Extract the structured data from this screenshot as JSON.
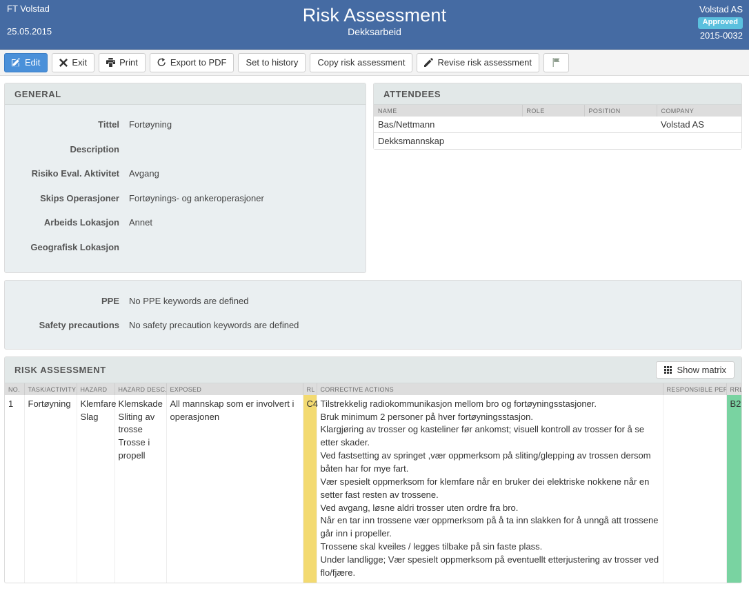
{
  "header": {
    "vessel": "FT Volstad",
    "date": "25.05.2015",
    "title": "Risk Assessment",
    "subtitle": "Dekksarbeid",
    "company": "Volstad AS",
    "status_badge": "Approved",
    "doc_number": "2015-0032",
    "bg_color": "#456ba3",
    "badge_color": "#5bc0de"
  },
  "toolbar": {
    "buttons": [
      {
        "label": "Edit",
        "icon": "pencil-square-icon",
        "primary": true
      },
      {
        "label": "Exit",
        "icon": "close-x-icon",
        "primary": false
      },
      {
        "label": "Print",
        "icon": "printer-icon",
        "primary": false
      },
      {
        "label": "Export to PDF",
        "icon": "external-share-icon",
        "primary": false
      },
      {
        "label": "Set to history",
        "icon": "",
        "primary": false
      },
      {
        "label": "Copy risk assessment",
        "icon": "",
        "primary": false
      },
      {
        "label": "Revise risk assessment",
        "icon": "pencil-icon",
        "primary": false
      },
      {
        "label": "",
        "icon": "flag-icon",
        "primary": false
      }
    ]
  },
  "general": {
    "title": "GENERAL",
    "fields": [
      {
        "label": "Tittel",
        "value": "Fortøyning"
      },
      {
        "label": "Description",
        "value": ""
      },
      {
        "label": "Risiko Eval. Aktivitet",
        "value": "Avgang"
      },
      {
        "label": "Skips Operasjoner",
        "value": "Fortøynings- og ankeroperasjoner"
      },
      {
        "label": "Arbeids Lokasjon",
        "value": "Annet"
      },
      {
        "label": "Geografisk Lokasjon",
        "value": ""
      }
    ]
  },
  "attendees": {
    "title": "ATTENDEES",
    "columns": [
      "NAME",
      "ROLE",
      "POSITION",
      "COMPANY"
    ],
    "rows": [
      {
        "name": "Bas/Nettmann",
        "role": "",
        "position": "",
        "company": "Volstad AS"
      },
      {
        "name": "Dekksmannskap",
        "role": "",
        "position": "",
        "company": ""
      }
    ]
  },
  "ppe": {
    "fields": [
      {
        "label": "PPE",
        "value": "No PPE keywords are defined"
      },
      {
        "label": "Safety precautions",
        "value": "No safety precaution keywords are defined"
      }
    ]
  },
  "risk": {
    "title": "RISK ASSESSMENT",
    "show_matrix_label": "Show matrix",
    "columns": [
      "NO.",
      "TASK/ACTIVITY",
      "HAZARD",
      "HAZARD DESC.",
      "EXPOSED",
      "RL",
      "CORRECTIVE ACTIONS",
      "RESPONSIBLE PERSON",
      "RRL"
    ],
    "rows": [
      {
        "no": "1",
        "task": "Fortøyning",
        "hazard": [
          "Klemfare",
          "Slag"
        ],
        "hazard_desc": [
          "Klemskade",
          "Sliting av trosse",
          "Trosse i propell"
        ],
        "exposed": "All mannskap som er involvert i operasjonen",
        "rl": "C4",
        "rl_color": "#f3da71",
        "corrective_actions": [
          "Tilstrekkelig radiokommunikasjon mellom bro og fortøyningsstasjoner.",
          "Bruk minimum 2 personer på hver fortøyningsstasjon.",
          "Klargjøring av trosser og kasteliner før ankomst; visuell kontroll av trosser for å se etter skader.",
          "Ved fastsetting av springet ,vær oppmerksom på sliting/glepping av trossen dersom båten har for mye fart.",
          "Vær spesielt oppmerksom for klemfare når en bruker dei elektriske nokkene når en setter fast resten av trossene.",
          "Ved avgang, løsne aldri trosser uten ordre fra bro.",
          "Når en tar inn trossene vær oppmerksom på å ta inn slakken for å unngå att trossene går inn i propeller.",
          "Trossene skal kveiles / legges tilbake på sin faste plass.",
          "Under landligge; Vær spesielt oppmerksom på eventuellt etterjustering av trosser ved flo/fjære."
        ],
        "responsible_person": "",
        "rrl": "B2",
        "rrl_color": "#79d3a1"
      }
    ]
  }
}
